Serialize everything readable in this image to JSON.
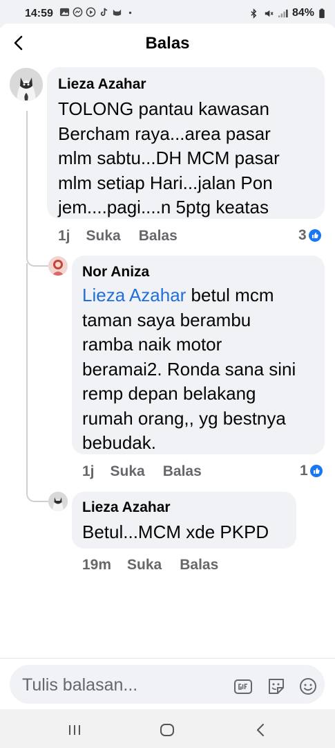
{
  "status_bar": {
    "time": "14:59",
    "battery": "84%"
  },
  "header": {
    "title": "Balas"
  },
  "comments": [
    {
      "author": "Lieza Azahar",
      "mention": "",
      "text": "TOLONG pantau kawasan\nBercham raya...area pasar\nmlm sabtu...DH MCM pasar\nmlm setiap Hari...jalan Pon\njem....pagi....n 5ptg keatas",
      "time": "1j",
      "like_label": "Suka",
      "reply_label": "Balas",
      "reactions": "3"
    },
    {
      "author": "Nor Aniza",
      "mention": "Lieza Azahar",
      "text": " betul mcm\ntaman saya berambu\nramba naik motor\nberamai2. Ronda sana sini\nremp depan belakang\nrumah orang,, yg bestnya\nbebudak.",
      "time": "1j",
      "like_label": "Suka",
      "reply_label": "Balas",
      "reactions": "1"
    },
    {
      "author": "Lieza Azahar",
      "mention": "",
      "text": "Betul...MCM xde PKPD",
      "time": "19m",
      "like_label": "Suka",
      "reply_label": "Balas",
      "reactions": ""
    }
  ],
  "composer": {
    "placeholder": "Tulis balasan..."
  },
  "colors": {
    "link": "#216fdb",
    "like": "#1877f2",
    "bubble": "#f0f2f5",
    "muted": "#65676b"
  },
  "icons": [
    "back-arrow-icon",
    "like-icon",
    "gif-icon",
    "sticker-icon",
    "emoji-icon",
    "recent-apps-icon",
    "home-icon",
    "nav-back-icon"
  ]
}
